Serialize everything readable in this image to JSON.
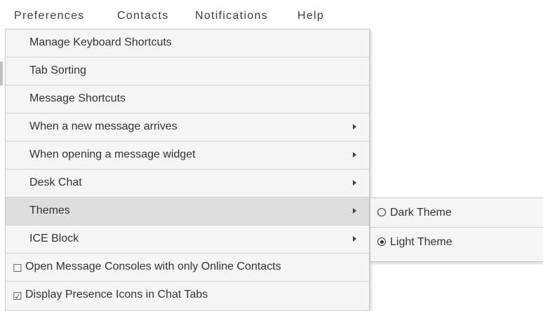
{
  "menubar": {
    "items": [
      {
        "label": "Preferences"
      },
      {
        "label": "Contacts"
      },
      {
        "label": "Notifications"
      },
      {
        "label": "Help"
      }
    ]
  },
  "menu": {
    "items": [
      {
        "label": "Manage Keyboard Shortcuts"
      },
      {
        "label": "Tab Sorting"
      },
      {
        "label": "Message Shortcuts"
      },
      {
        "label": "When a new message arrives",
        "submenu": true
      },
      {
        "label": "When opening a message widget",
        "submenu": true
      },
      {
        "label": "Desk Chat",
        "submenu": true
      },
      {
        "label": "Themes",
        "submenu": true,
        "active": true
      },
      {
        "label": "ICE Block",
        "submenu": true
      },
      {
        "label": "Open Message Consoles with only Online Contacts",
        "checkbox": "☐",
        "checked": false
      },
      {
        "label": "Display Presence Icons in Chat Tabs",
        "checkbox": "☑",
        "checked": true
      }
    ]
  },
  "themes_submenu": {
    "items": [
      {
        "label": "Dark Theme",
        "selected": false
      },
      {
        "label": "Light Theme",
        "selected": true
      }
    ]
  },
  "colors": {
    "menu_bg": "#f5f5f5",
    "active_bg": "#dedede",
    "text": "#333333"
  }
}
